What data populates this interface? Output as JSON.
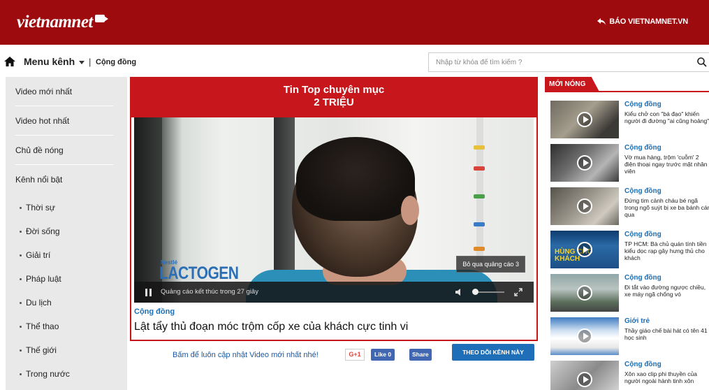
{
  "header": {
    "logo_text": "vietnamnet",
    "logo_sub": "VIETNAMNET.VN",
    "back_link": "BÁO VIETNAMNET.VN",
    "brand_color": "#9e0b0f"
  },
  "nav": {
    "menu_label": "Menu kênh",
    "separator": "|",
    "breadcrumb": "Cộng đồng",
    "search_placeholder": "Nhập từ khóa để tìm kiếm ?"
  },
  "sidebar": {
    "main_items": [
      "Video mới nhất",
      "Video hot nhất",
      "Chủ đề nóng",
      "Kênh nổi bật"
    ],
    "sub_items": [
      "Thời sự",
      "Đời sống",
      "Giải trí",
      "Pháp luật",
      "Du lịch",
      "Thể thao",
      "Thế giới",
      "Trong nước"
    ]
  },
  "card": {
    "heading_line1": "Tin Top chuyên mục",
    "heading_line2": "2 TRIỆU",
    "category": "Cộng đồng",
    "title": "Lật tẩy thủ đoạn móc trộm cốp xe của khách cực tinh vi",
    "accent_color": "#c8161d"
  },
  "player": {
    "ad_brand_small": "Nestlé",
    "ad_brand": "LACTOGEN",
    "skip_label": "Bỏ qua quảng cáo 3",
    "ad_countdown": "Quảng cáo kết thúc trong 27 giây"
  },
  "subscribe": {
    "text": "Bấm để luôn cập nhật Video mới nhất nhé!",
    "gplus": "G+1",
    "like": "Like 0",
    "share": "Share",
    "follow": "THEO DÕI KÊNH NÀY"
  },
  "hot": {
    "tab_label": "MỚI NÓNG",
    "items": [
      {
        "category": "Cộng đồng",
        "title": "Kiểu chở con \"bá đạo\" khiến người đi đường \"ai cũng hoảng\""
      },
      {
        "category": "Cộng đồng",
        "title": "Vờ mua hàng, trộm 'cuỗm' 2 điện thoại ngay trước mặt nhân viên"
      },
      {
        "category": "Cộng đồng",
        "title": "Đứng tim cảnh cháu bé ngã trong ngõ suýt bị xe ba bánh cán qua"
      },
      {
        "category": "Cộng đồng",
        "title": "TP HCM: Bà chủ quán tính tiền kiểu dọc rạp gây hưng thủ cho khách",
        "thumb_text": "HÙNG CHO KHÁCH"
      },
      {
        "category": "Cộng đồng",
        "title": "Đi tắt vào đường ngược chiều, xe máy ngã chổng vó"
      },
      {
        "category": "Giới trẻ",
        "title": "Thầy giáo chế bài hát có tên 41 học sinh"
      },
      {
        "category": "Cộng đồng",
        "title": "Xôn xao clip phi thuyền của người ngoài hành tinh xôn"
      }
    ]
  }
}
